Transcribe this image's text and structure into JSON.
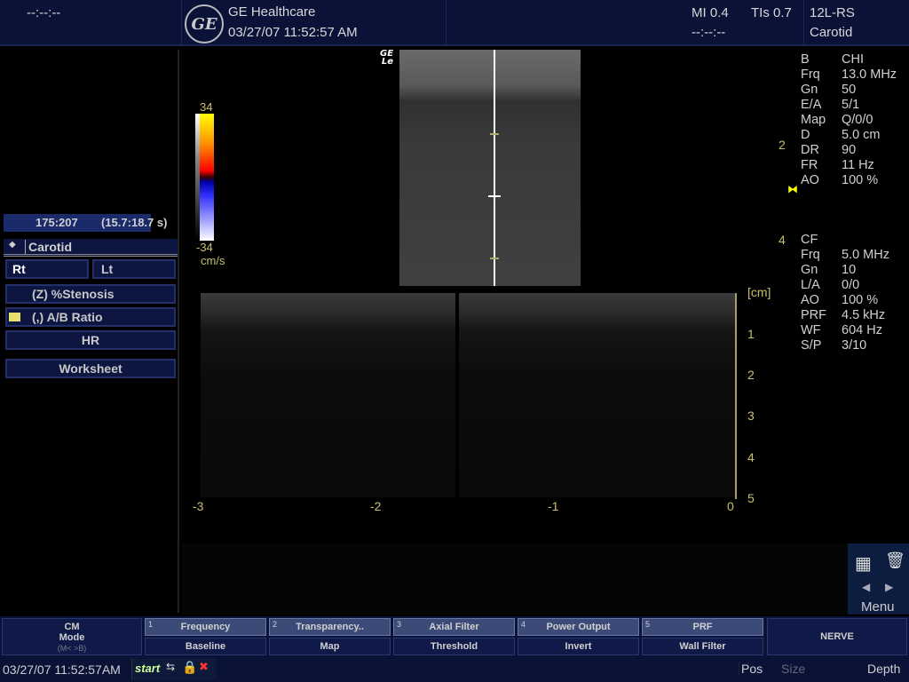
{
  "header": {
    "left_time": "--:--:--",
    "brand": "GE Healthcare",
    "datetime": "03/27/07 11:52:57 AM",
    "mi": "MI 0.4",
    "tis": "TIs 0.7",
    "elapsed": "--:--:--",
    "probe": "12L-RS",
    "preset": "Carotid",
    "logo": "GE"
  },
  "left_panel": {
    "cine": "175:207",
    "cine_time": "(15.7:18.7 s)",
    "title": "Carotid",
    "buttons": [
      "Rt",
      "Lt",
      "(Z)  %Stenosis",
      "(,)  A/B Ratio",
      "HR",
      "Worksheet"
    ]
  },
  "color_bar": {
    "max": "34",
    "min": "-34",
    "unit": "cm/s"
  },
  "image": {
    "logo_mark": "GE\nLe"
  },
  "mmode_axis": {
    "x_labels": [
      "-3",
      "-2",
      "-1",
      "0"
    ],
    "depth_unit": "[cm]",
    "depth_labels": [
      "1",
      "2",
      "3",
      "4",
      "5"
    ]
  },
  "depth_scale": {
    "labels": [
      "2",
      "4"
    ]
  },
  "params_b": [
    [
      "B",
      "CHI"
    ],
    [
      "Frq",
      "13.0 MHz"
    ],
    [
      "Gn",
      "50"
    ],
    [
      "E/A",
      "5/1"
    ],
    [
      "Map",
      "Q/0/0"
    ],
    [
      "D",
      "5.0 cm"
    ],
    [
      "DR",
      "90"
    ],
    [
      "FR",
      "11 Hz"
    ],
    [
      "AO",
      "100 %"
    ]
  ],
  "params_cf": [
    [
      "CF",
      ""
    ],
    [
      "Frq",
      "5.0 MHz"
    ],
    [
      "Gn",
      "10"
    ],
    [
      "L/A",
      "0/0"
    ],
    [
      "AO",
      "100 %"
    ],
    [
      "PRF",
      "4.5 kHz"
    ],
    [
      "WF",
      "604 Hz"
    ],
    [
      "S/P",
      "3/10"
    ]
  ],
  "menu": {
    "label": "Menu"
  },
  "softkeys": {
    "mode_title": "CM",
    "mode": "Mode",
    "mode_sub": "(M< >B)",
    "top": [
      [
        "1",
        "Frequency"
      ],
      [
        "2",
        "Transparency.."
      ],
      [
        "3",
        "Axial Filter"
      ],
      [
        "4",
        "Power Output"
      ],
      [
        "5",
        "PRF"
      ]
    ],
    "bottom": [
      "Baseline",
      "Map",
      "Threshold",
      "Invert",
      "Wall Filter"
    ],
    "nerve": "NERVE"
  },
  "status": {
    "datetime": "03/27/07 11:52:57AM",
    "start": "start",
    "pos": "Pos",
    "size": "Size",
    "depth": "Depth"
  }
}
